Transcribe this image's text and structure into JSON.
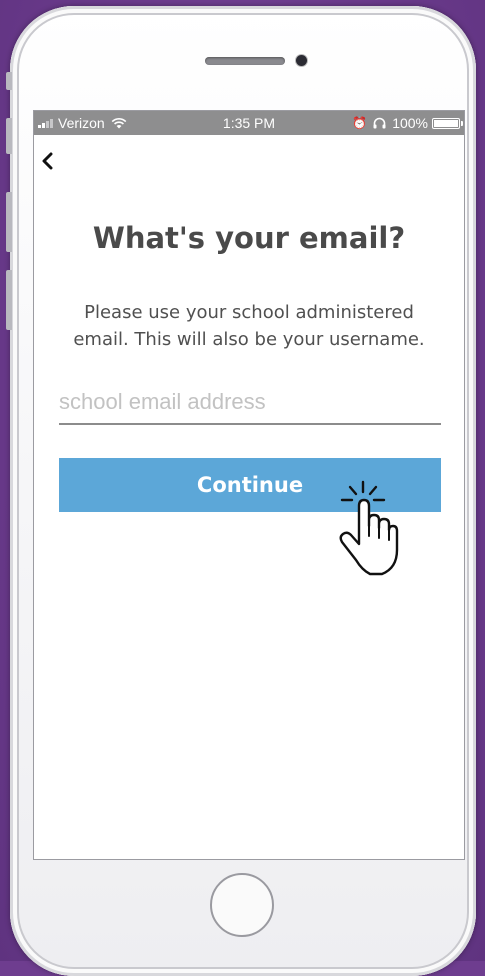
{
  "status_bar": {
    "carrier": "Verizon",
    "time": "1:35 PM",
    "battery": "100%"
  },
  "screen": {
    "title": "What's your email?",
    "subtitle": "Please use your school administered email. This will also be your username.",
    "email_input": {
      "value": "",
      "placeholder": "school email address"
    },
    "continue_label": "Continue"
  },
  "colors": {
    "button": "#5ca7d8",
    "frame_background": "#6e3d8f",
    "status_bar": "#8e8e8f"
  },
  "icons": {
    "back": "chevron-left-icon",
    "pointer": "tap-hand-icon"
  }
}
